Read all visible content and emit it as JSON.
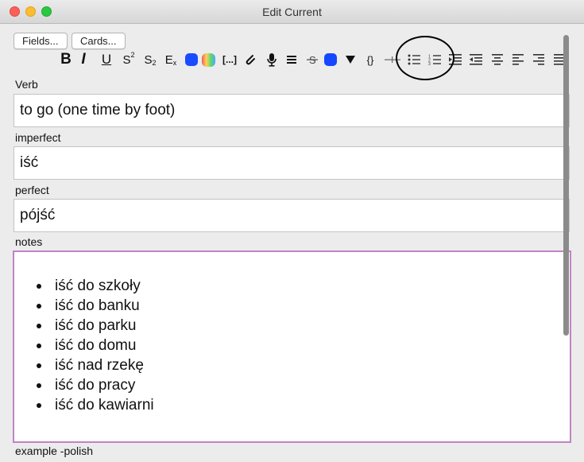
{
  "window": {
    "title": "Edit Current"
  },
  "topbar": {
    "fields_label": "Fields...",
    "cards_label": "Cards..."
  },
  "toolbar": {
    "bold": "B",
    "italic": "I",
    "underline": "U",
    "superscript": "S",
    "superscript_mark": "2",
    "subscript": "S",
    "subscript_mark": "2",
    "clear": "E",
    "clear_mark": "x",
    "cloze": "[...]",
    "mathjax": "{}"
  },
  "fields": [
    {
      "label": "Verb",
      "value": "to go (one time by foot)"
    },
    {
      "label": "imperfect",
      "value": "iść"
    },
    {
      "label": "perfect",
      "value": "pójść"
    },
    {
      "label": "notes",
      "items": [
        "iść do szkoły",
        "iść do banku",
        "iść do parku",
        "iść do domu",
        "iść nad rzekę",
        "iść do pracy",
        "iść do kawiarni"
      ]
    },
    {
      "label": "example -polish"
    }
  ],
  "colors": {
    "text_color": "#1a4cff",
    "highlight_blue": "#1447ff",
    "focus_border": "#c183c3"
  },
  "icons": [
    "attach-icon",
    "microphone-icon",
    "html-editor-icon",
    "strikethrough-icon",
    "dropdown-icon",
    "horizontal-rule-icon",
    "bullet-list-icon",
    "numbered-list-icon",
    "outdent-icon",
    "indent-icon",
    "align-center-icon",
    "align-left-icon",
    "align-right-icon",
    "justify-icon"
  ]
}
